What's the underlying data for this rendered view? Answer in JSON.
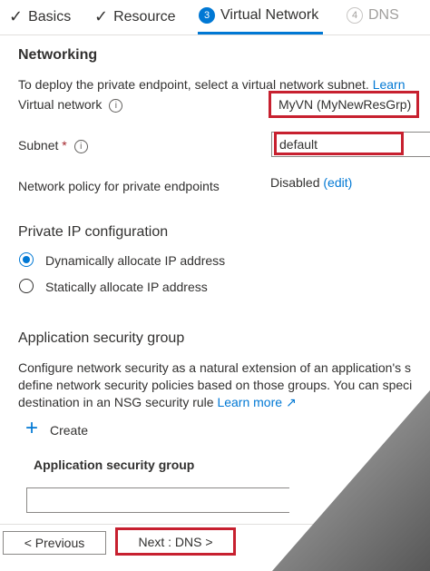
{
  "tabs": [
    {
      "label": "Basics",
      "status": "done"
    },
    {
      "label": "Resource",
      "status": "done"
    },
    {
      "label": "Virtual Network",
      "number": "3",
      "status": "active"
    },
    {
      "label": "DNS",
      "number": "4",
      "status": "disabled"
    }
  ],
  "networking": {
    "heading": "Networking",
    "intro": "To deploy the private endpoint, select a virtual network subnet.",
    "learn": "Learn",
    "vnet_label": "Virtual network",
    "vnet_value": "MyVN (MyNewResGrp)",
    "subnet_label": "Subnet",
    "subnet_required": "*",
    "subnet_value": "default",
    "policy_label": "Network policy for private endpoints",
    "policy_value": "Disabled",
    "policy_edit": "(edit)"
  },
  "ip_config": {
    "heading": "Private IP configuration",
    "options": [
      "Dynamically allocate IP address",
      "Statically allocate IP address"
    ],
    "selected": 0
  },
  "asg": {
    "heading": "Application security group",
    "desc_line1": "Configure network security as a natural extension of an application's s",
    "desc_line2": "define network security policies based on those groups. You can speci",
    "desc_line3": "destination in an NSG security rule",
    "learn_more": "Learn more",
    "create_label": "Create",
    "column_header": "Application security group"
  },
  "footer": {
    "previous": "< Previous",
    "next": "Next : DNS >"
  },
  "colors": {
    "accent": "#0078d4",
    "highlight": "#c7202f"
  }
}
